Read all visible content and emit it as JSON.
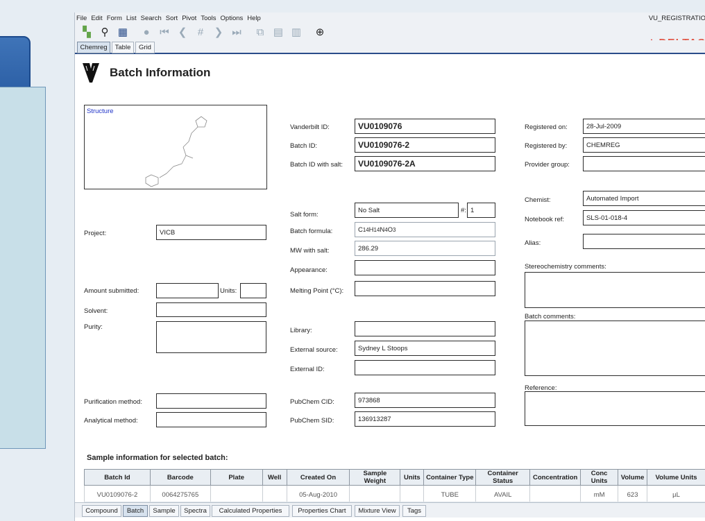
{
  "menu": [
    "File",
    "Edit",
    "Form",
    "List",
    "Search",
    "Sort",
    "Pivot",
    "Tools",
    "Options",
    "Help"
  ],
  "app_name": "VU_REGISTRATIO",
  "logo_text": "DELTAS",
  "view_tabs": [
    "Chemreg",
    "Table",
    "Grid"
  ],
  "page_title": "Batch Information",
  "structure_label": "Structure",
  "left": {
    "project_label": "Project:",
    "project_value": "VICB",
    "amount_label": "Amount submitted:",
    "units_label": "Units:",
    "solvent_label": "Solvent:",
    "purity_label": "Purity:",
    "purification_label": "Purification method:",
    "analytical_label": "Analytical method:"
  },
  "middle": {
    "vid_label": "Vanderbilt ID:",
    "vid_value": "VU0109076",
    "batch_label": "Batch ID:",
    "batch_value": "VU0109076-2",
    "batchsalt_label": "Batch ID with salt:",
    "batchsalt_value": "VU0109076-2A",
    "salt_label": "Salt form:",
    "salt_value": "No Salt",
    "num_label": "#:",
    "num_value": "1",
    "formula_label": "Batch formula:",
    "formula_value": "C14H14N4O3",
    "mw_label": "MW with salt:",
    "mw_value": "286.29",
    "appearance_label": "Appearance:",
    "melting_label": "Melting Point (°C):",
    "library_label": "Library:",
    "extsource_label": "External source:",
    "extsource_value": "Sydney L Stoops",
    "extid_label": "External ID:",
    "cid_label": "PubChem CID:",
    "cid_value": "973868",
    "sid_label": "PubChem SID:",
    "sid_value": "136913287"
  },
  "right": {
    "regon_label": "Registered on:",
    "regon_value": "28-Jul-2009",
    "regby_label": "Registered by:",
    "regby_value": "CHEMREG",
    "provider_label": "Provider group:",
    "chemist_label": "Chemist:",
    "chemist_value": "Automated Import",
    "notebook_label": "Notebook ref:",
    "notebook_value": "SLS-01-018-4",
    "alias_label": "Alias:",
    "stereo_label": "Stereochemistry comments:",
    "batchcomments_label": "Batch comments:",
    "reference_label": "Reference:"
  },
  "sample_header": "Sample information for selected batch:",
  "sample_columns": [
    "Batch Id",
    "Barcode",
    "Plate",
    "Well",
    "Created On",
    "Sample Weight",
    "Units",
    "Container Type",
    "Container Status",
    "Concentration",
    "Conc Units",
    "Volume",
    "Volume Units"
  ],
  "sample_rows": [
    [
      "VU0109076-2",
      "0064275765",
      "",
      "",
      "05-Aug-2010",
      "",
      "",
      "TUBE",
      "AVAIL",
      "",
      "mM",
      "623",
      "µL"
    ]
  ],
  "bottom_tabs": [
    "Compound",
    "Batch",
    "Sample",
    "Spectra",
    "Calculated Properties",
    "Properties Chart",
    "Mixture View",
    "Tags"
  ],
  "active_view_tab": "Chemreg",
  "active_bottom_tab": "Batch",
  "toolbar_icons": [
    "chart-icon",
    "binoculars-icon",
    "form-view-icon",
    "stop-icon",
    "first-record-icon",
    "previous-record-icon",
    "goto-record-icon",
    "next-record-icon",
    "last-record-icon",
    "copy-icon",
    "paste-icon",
    "paste-append-icon",
    "crosshair-icon"
  ]
}
